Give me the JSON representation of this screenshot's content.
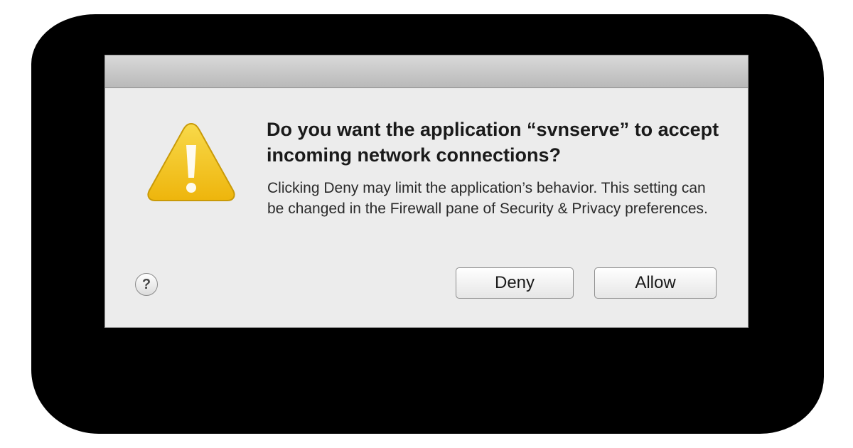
{
  "dialog": {
    "heading": "Do you want the application “svnserve” to accept incoming network connections?",
    "body": "Clicking Deny may limit the application’s behavior. This setting can be changed in the Firewall pane of Security & Privacy preferences.",
    "help_label": "?",
    "deny_label": "Deny",
    "allow_label": "Allow",
    "icon": "warning-triangle-icon",
    "colors": {
      "dialog_background": "#ececec",
      "warning_yellow": "#f2c318",
      "backdrop": "#000000"
    }
  }
}
